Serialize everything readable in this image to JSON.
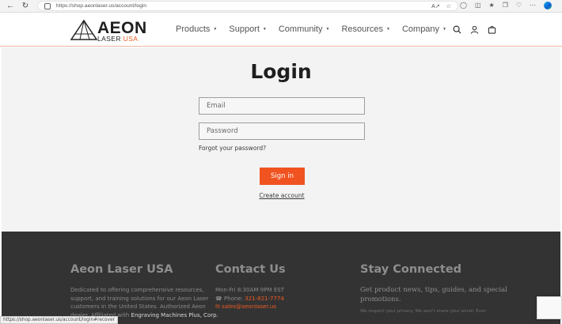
{
  "browser": {
    "url": "https://shop.aeonlaser.us/account/login",
    "status_url": "https://shop.aeonlaser.us/account/login#recover"
  },
  "header": {
    "logo_word": "AEON",
    "logo_laser": "LASER",
    "logo_usa": "USA",
    "nav": [
      {
        "label": "Products"
      },
      {
        "label": "Support"
      },
      {
        "label": "Community"
      },
      {
        "label": "Resources"
      },
      {
        "label": "Company"
      }
    ]
  },
  "login": {
    "title": "Login",
    "email_placeholder": "Email",
    "password_placeholder": "Password",
    "forgot": "Forgot your password?",
    "signin": "Sign in",
    "create": "Create account"
  },
  "footer": {
    "about": {
      "title": "Aeon Laser USA",
      "line1": "Dedicated to offering comprehensive resources,",
      "line2": "support, and training solutions for our Aeon Laser",
      "line3": "customers in the United States. Authorized Aeon",
      "line4_start": "dealer. Affiliated with ",
      "line4_link": "Engraving Machines Plus, Corp."
    },
    "contact": {
      "title": "Contact Us",
      "hours": "Mon-Fri 8:30AM-9PM EST",
      "phone_label": "Phone: ",
      "phone": "321-821-7774",
      "email": "sales@aeonlaser.us"
    },
    "stay": {
      "title": "Stay Connected",
      "line1": "Get product news, tips, guides, and special",
      "line2": "promotions.",
      "note": "We respect your privacy. We won't share your email. Ever."
    }
  },
  "colors": {
    "accent": "#f0531f",
    "footer_bg": "#333333",
    "page_bg": "#f3f3f3"
  }
}
